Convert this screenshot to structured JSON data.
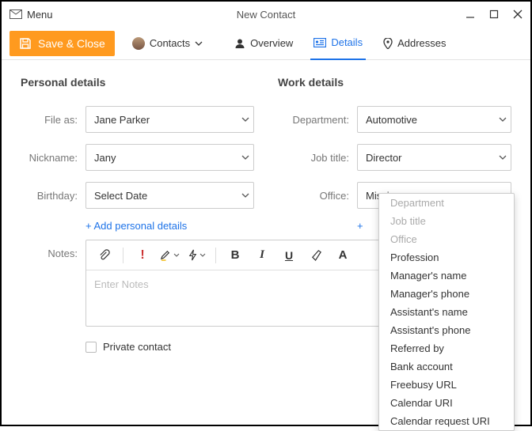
{
  "titlebar": {
    "menu": "Menu",
    "title": "New Contact"
  },
  "toolbar": {
    "save": "Save & Close",
    "contacts": "Contacts",
    "overview": "Overview",
    "details": "Details",
    "addresses": "Addresses"
  },
  "personal": {
    "heading": "Personal details",
    "file_as_label": "File as:",
    "file_as_value": "Jane Parker",
    "nickname_label": "Nickname:",
    "nickname_value": "Jany",
    "birthday_label": "Birthday:",
    "birthday_value": "Select Date",
    "add_link": "+ Add personal details"
  },
  "work": {
    "heading": "Work details",
    "department_label": "Department:",
    "department_value": "Automotive",
    "jobtitle_label": "Job title:",
    "jobtitle_value": "Director",
    "office_label": "Office:",
    "office_value": "Mission",
    "add_link": "+"
  },
  "notes": {
    "label": "Notes:",
    "placeholder": "Enter Notes"
  },
  "private": {
    "label": "Private contact"
  },
  "dropdown": {
    "items": [
      {
        "label": "Department",
        "disabled": true
      },
      {
        "label": "Job title",
        "disabled": true
      },
      {
        "label": "Office",
        "disabled": true
      },
      {
        "label": "Profession",
        "disabled": false
      },
      {
        "label": "Manager's name",
        "disabled": false
      },
      {
        "label": "Manager's phone",
        "disabled": false
      },
      {
        "label": "Assistant's name",
        "disabled": false
      },
      {
        "label": "Assistant's phone",
        "disabled": false
      },
      {
        "label": "Referred by",
        "disabled": false
      },
      {
        "label": "Bank account",
        "disabled": false
      },
      {
        "label": "Freebusy URL",
        "disabled": false
      },
      {
        "label": "Calendar URI",
        "disabled": false
      },
      {
        "label": "Calendar request URI",
        "disabled": false
      }
    ]
  }
}
